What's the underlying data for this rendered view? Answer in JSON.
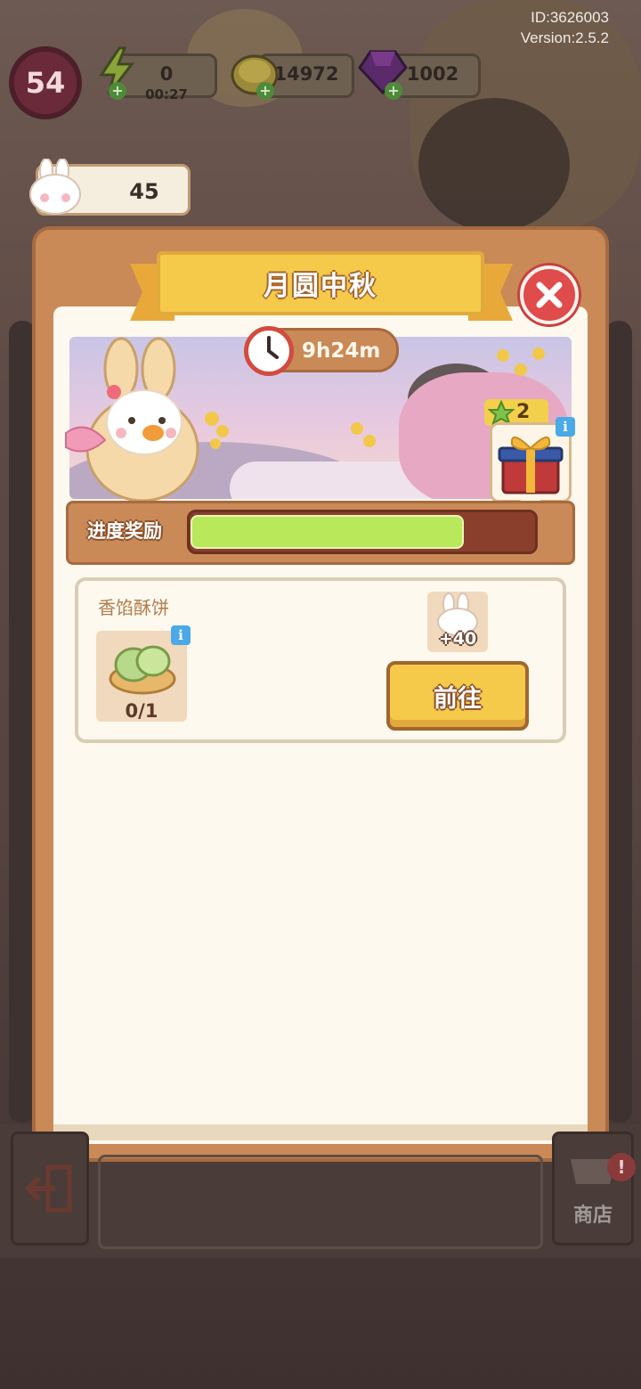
{
  "hud": {
    "player_id": "ID:3626003",
    "version": "Version:2.5.2",
    "level": "54",
    "energy_value": "0",
    "energy_timer": "00:27",
    "coins": "14972",
    "gems": "1002",
    "bunny_count": "45"
  },
  "event": {
    "title": "月圆中秋",
    "time_remaining": "9h24m",
    "chest_stars": "2",
    "progress_label": "进度奖励",
    "progress_fraction": 0.8
  },
  "task": {
    "name": "香馅酥饼",
    "progress": "0/1",
    "reward_amount": "+40",
    "go_label": "前往"
  },
  "bottom_nav": {
    "shop_label": "商店",
    "alert_mark": "!"
  },
  "colors": {
    "accent_gold": "#f5c94a",
    "dialog_brown": "#c98a57",
    "progress_green": "#b9e85a",
    "close_red": "#e04b4b",
    "info_blue": "#4aa9e6"
  }
}
